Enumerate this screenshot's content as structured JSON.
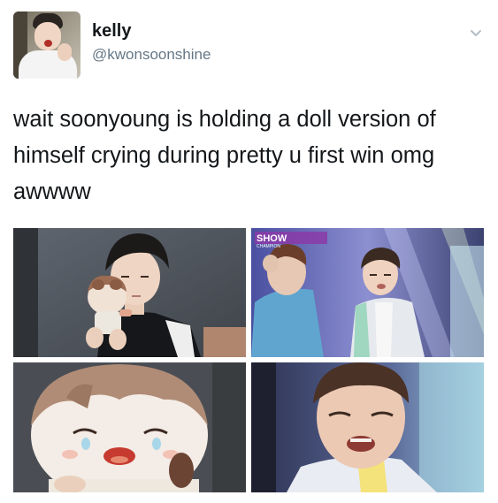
{
  "tweet": {
    "display_name": "kelly",
    "handle": "@kwonsoonshine",
    "text": "wait soonyoung is holding a doll version of\nhimself crying during pretty u first win omg\nawwww"
  },
  "media": {
    "count": 4,
    "photo2_overlay": "SHOW",
    "photo2_overlay_sub": "CHAMPION"
  },
  "icons": {
    "menu": "chevron-down-icon",
    "avatar": "profile-photo"
  },
  "colors": {
    "text": "#14171a",
    "secondary": "#657786",
    "chevron": "#aab8c2"
  }
}
